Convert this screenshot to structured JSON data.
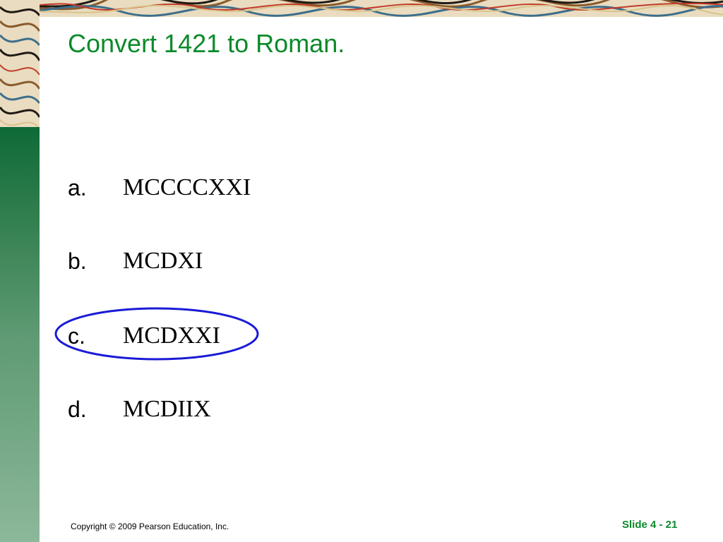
{
  "slide": {
    "title": "Convert 1421 to Roman.",
    "options": [
      {
        "letter": "a.",
        "text": "MCCCCXXI"
      },
      {
        "letter": "b.",
        "text": "MCDXI"
      },
      {
        "letter": "c.",
        "text": "MCDXXI"
      },
      {
        "letter": "d.",
        "text": "MCDIIX"
      }
    ],
    "selected_option": "c.",
    "footer": {
      "copyright": "Copyright © 2009 Pearson Education, Inc.",
      "slide_number": "Slide 4 - 21"
    }
  },
  "colors": {
    "title": "#0b8a2a",
    "circle": "#1a1ad6",
    "side_strip_top": "#0e6a38",
    "side_strip_bottom": "#8cb89a",
    "marble_base": "#e9dcc0"
  }
}
